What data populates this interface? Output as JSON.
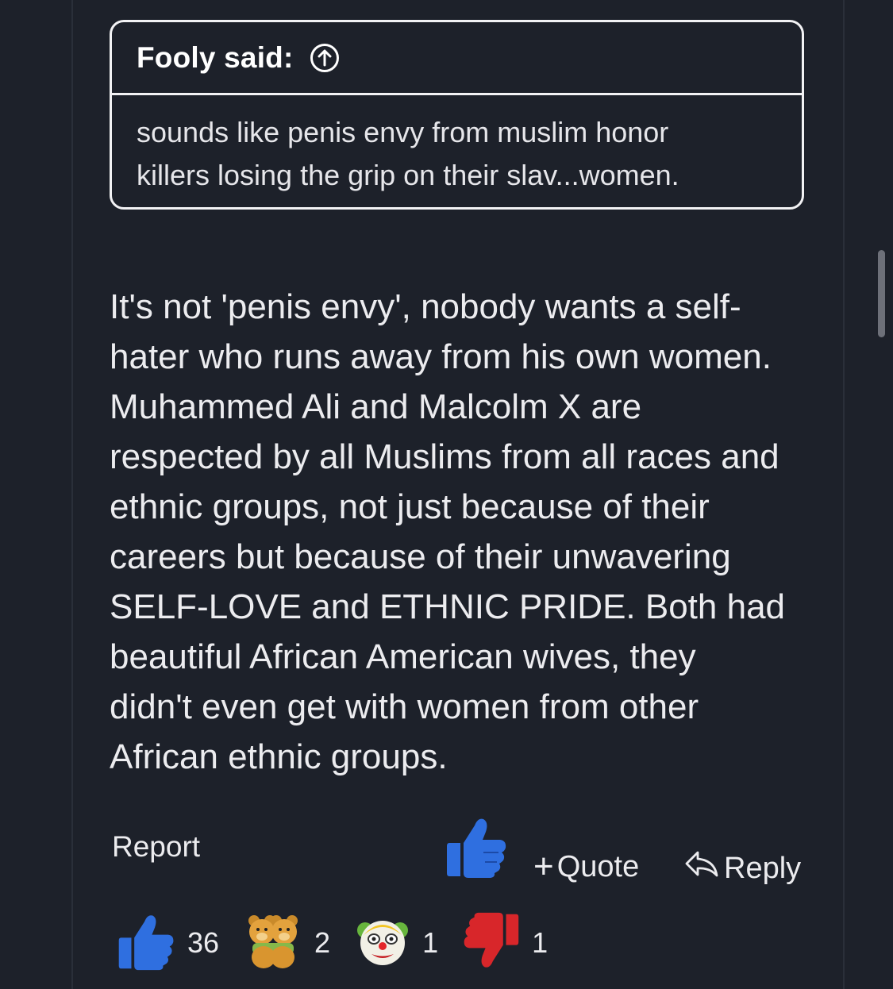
{
  "quote": {
    "author": "Fooly said:",
    "text_line1": "sounds like penis envy from muslim honor",
    "text_line2": "killers losing the grip on their slav...women."
  },
  "post": {
    "lines": [
      "It's not 'penis envy', nobody wants a self-",
      "hater who runs away from his own women.",
      "Muhammed Ali and Malcolm X are",
      "respected by all Muslims from all races and",
      "ethnic groups, not just because of their",
      "careers but because of their unwavering",
      "SELF-LOVE and ETHNIC PRIDE. Both had",
      "beautiful African American wives, they",
      "didn't even get with women from other",
      "African ethnic groups."
    ]
  },
  "actions": {
    "report_label": "Report",
    "quote_label": "Quote",
    "reply_label": "Reply"
  },
  "reactions": [
    {
      "icon": "thumbs-up-icon",
      "count": "36"
    },
    {
      "icon": "hug-bears-icon",
      "count": "2"
    },
    {
      "icon": "clown-face-icon",
      "count": "1"
    },
    {
      "icon": "thumbs-down-icon",
      "count": "1"
    }
  ],
  "colors": {
    "background": "#1d212a",
    "text": "#ececef",
    "like_blue": "#2f6fe0",
    "dislike_red": "#d8262a"
  }
}
